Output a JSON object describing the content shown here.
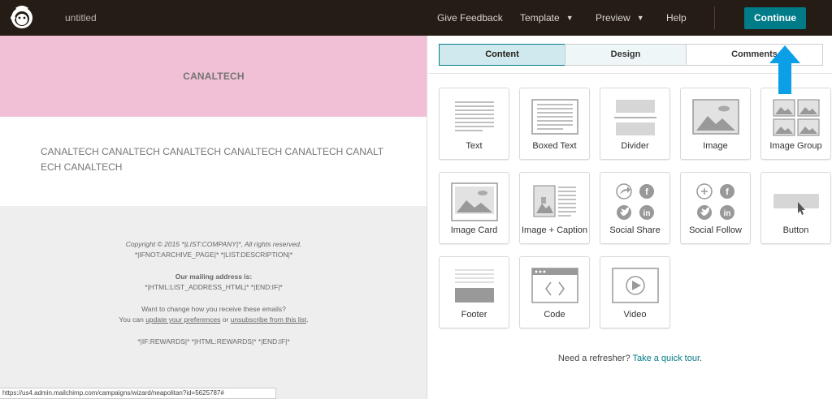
{
  "topbar": {
    "title": "untitled",
    "nav": {
      "give_feedback": "Give Feedback",
      "template": "Template",
      "preview": "Preview",
      "help": "Help"
    },
    "continue_label": "Continue"
  },
  "preview": {
    "header_text": "CANALTECH",
    "body_text": "CANALTECH CANALTECH CANALTECH CANALTECH CANALTECH CANALTECH CANALTECH",
    "footer": {
      "copyright": "Copyright © 2015 *|LIST:COMPANY|*, All rights reserved.",
      "archive_line": "*|IFNOT:ARCHIVE_PAGE|* *|LIST:DESCRIPTION|*",
      "mailing_heading": "Our mailing address is:",
      "mailing_line": "*|HTML:LIST_ADDRESS_HTML|* *|END:IF|*",
      "change_line": "Want to change how you receive these emails?",
      "you_can": "You can",
      "update_link": "update your preferences",
      "or_text": "or",
      "unsubscribe_link": "unsubscribe from this list",
      "period": ".",
      "rewards_line": "*|IF:REWARDS|* *|HTML:REWARDS|* *|END:IF|*"
    },
    "status_url": "https://us4.admin.mailchimp.com/campaigns/wizard/neapolitan?id=5625787#"
  },
  "panel": {
    "tabs": [
      "Content",
      "Design",
      "Comments"
    ],
    "blocks": [
      {
        "label": "Text",
        "icon": "text-block-icon"
      },
      {
        "label": "Boxed Text",
        "icon": "boxed-text-block-icon"
      },
      {
        "label": "Divider",
        "icon": "divider-block-icon"
      },
      {
        "label": "Image",
        "icon": "image-block-icon"
      },
      {
        "label": "Image Group",
        "icon": "image-group-block-icon"
      },
      {
        "label": "Image Card",
        "icon": "image-card-block-icon"
      },
      {
        "label": "Image + Caption",
        "icon": "image-caption-block-icon"
      },
      {
        "label": "Social Share",
        "icon": "social-share-block-icon"
      },
      {
        "label": "Social Follow",
        "icon": "social-follow-block-icon"
      },
      {
        "label": "Button",
        "icon": "button-block-icon"
      },
      {
        "label": "Footer",
        "icon": "footer-block-icon"
      },
      {
        "label": "Code",
        "icon": "code-block-icon"
      },
      {
        "label": "Video",
        "icon": "video-block-icon"
      }
    ],
    "refresher_text": "Need a refresher?",
    "tour_link": "Take a quick tour",
    "refresher_end": "."
  },
  "colors": {
    "topbar": "#241c15",
    "accent": "#007c89",
    "header_pink": "#f2c0d6",
    "annotation_arrow": "#0a9fe6"
  }
}
